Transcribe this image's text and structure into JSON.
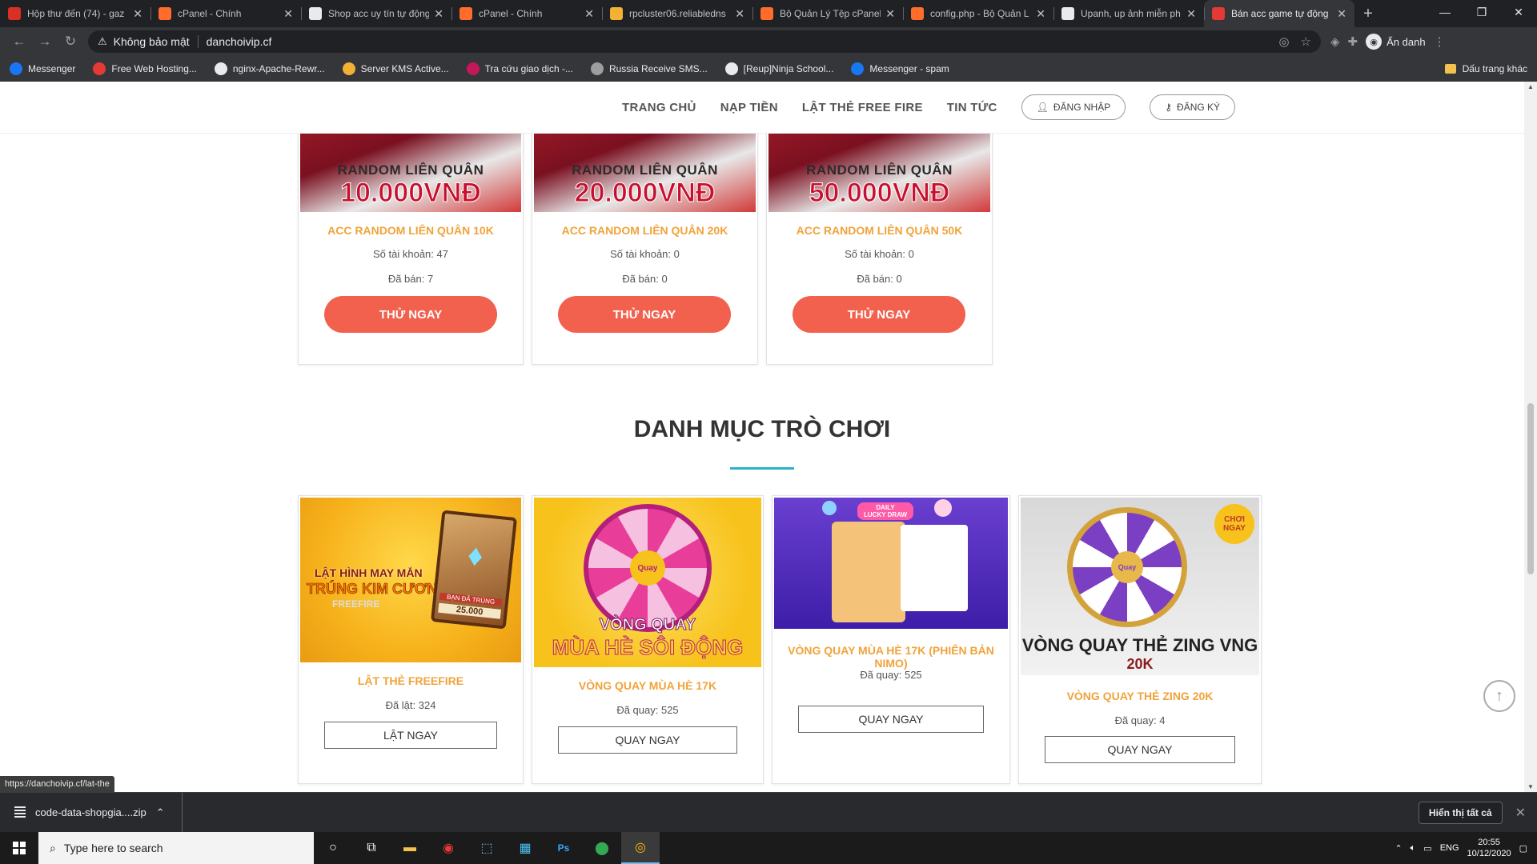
{
  "browser": {
    "tabs": [
      {
        "title": "Hộp thư đến (74) - gaz",
        "icon": "gmail-icon",
        "color": "#d93025",
        "active": false
      },
      {
        "title": "cPanel - Chính",
        "icon": "cpanel-icon",
        "color": "#ff6c2c",
        "active": false
      },
      {
        "title": "Shop acc uy tín tự động",
        "icon": "globe-icon",
        "color": "#e8eaed",
        "active": false
      },
      {
        "title": "cPanel - Chính",
        "icon": "cpanel-icon",
        "color": "#ff6c2c",
        "active": false
      },
      {
        "title": "rpcluster06.reliabledns",
        "icon": "server-icon",
        "color": "#f2b134",
        "active": false
      },
      {
        "title": "Bộ Quản Lý Tệp cPanel",
        "icon": "cpanel-icon",
        "color": "#ff6c2c",
        "active": false
      },
      {
        "title": "config.php - Bộ Quản L",
        "icon": "cpanel-icon",
        "color": "#ff6c2c",
        "active": false
      },
      {
        "title": "Upanh, up ảnh miễn ph",
        "icon": "globe-icon",
        "color": "#e8eaed",
        "active": false
      },
      {
        "title": "Bán acc game tự động",
        "icon": "gift-icon",
        "color": "#e53935",
        "active": true
      }
    ],
    "security_label": "Không bảo mật",
    "url": "danchoivip.cf",
    "incognito_label": "Ẩn danh",
    "bookmarks": [
      {
        "label": "Messenger",
        "icon": "facebook-icon",
        "color": "#1877f2"
      },
      {
        "label": "Free Web Hosting...",
        "icon": "hosting-icon",
        "color": "#e53935"
      },
      {
        "label": "nginx-Apache-Rewr...",
        "icon": "globe-icon",
        "color": "#e8eaed"
      },
      {
        "label": "Server KMS Active...",
        "icon": "star-icon",
        "color": "#f2b134"
      },
      {
        "label": "Tra cứu giao dịch -...",
        "icon": "bank-icon",
        "color": "#c2185b"
      },
      {
        "label": "Russia Receive SMS...",
        "icon": "phone-icon",
        "color": "#9e9e9e"
      },
      {
        "label": "[Reup]Ninja School...",
        "icon": "globe-icon",
        "color": "#e8eaed"
      },
      {
        "label": "Messenger - spam",
        "icon": "facebook-icon",
        "color": "#1877f2"
      }
    ],
    "other_bookmarks": "Dấu trang khác"
  },
  "site": {
    "nav": {
      "home": "TRANG CHỦ",
      "topup": "NẠP TIỀN",
      "flip": "LẬT THẺ FREE FIRE",
      "news": "TIN TỨC",
      "login": "ĐĂNG NHẬP",
      "register": "ĐĂNG KÝ"
    },
    "random_cards": [
      {
        "banner_top": "RANDOM LIÊN QUÂN",
        "banner_price": "10.000VNĐ",
        "title": "ACC RANDOM LIÊN QUÂN 10K",
        "accounts": "Số tài khoản: 47",
        "sold": "Đã bán: 7",
        "button": "THỬ NGAY"
      },
      {
        "banner_top": "RANDOM LIÊN QUÂN",
        "banner_price": "20.000VNĐ",
        "title": "ACC RANDOM LIÊN QUÂN 20K",
        "accounts": "Số tài khoản: 0",
        "sold": "Đã bán: 0",
        "button": "THỬ NGAY"
      },
      {
        "banner_top": "RANDOM LIÊN QUÂN",
        "banner_price": "50.000VNĐ",
        "title": "ACC RANDOM LIÊN QUÂN 50K",
        "accounts": "Số tài khoản: 0",
        "sold": "Đã bán: 0",
        "button": "THỬ NGAY"
      }
    ],
    "section_title": "DANH MỤC TRÒ CHƠI",
    "games": [
      {
        "img_text_1": "LẬT HÌNH MAY MẮN",
        "img_text_2": "TRÚNG KIM CƯƠNG",
        "img_text_3": "FREEFIRE",
        "img_badge": "BẠN ĐÃ TRÚNG",
        "img_value": "25.000",
        "title": "LẬT THẺ FREEFIRE",
        "stat": "Đã lật: 324",
        "button": "LẬT NGAY"
      },
      {
        "img_text_1": "VÒNG QUAY",
        "img_text_2": "MÙA HÈ SÔI ĐỘNG",
        "img_wheel": "Quay",
        "title": "VÒNG QUAY MÙA HÈ 17K",
        "stat": "Đã quay: 525",
        "button": "QUAY NGAY"
      },
      {
        "img_text_1": "DAILY",
        "img_text_2": "LUCKY DRAW",
        "title": "VÒNG QUAY MÙA HÈ 17K (PHIÊN BẢN NIMO)",
        "stat": "Đã quay: 525",
        "button": "QUAY NGAY"
      },
      {
        "img_text_1": "VÒNG QUAY THẺ ZING VNG",
        "img_text_2": "20K",
        "img_badge": "CHƠI NGAY",
        "img_wheel": "Quay",
        "title": "VÒNG QUAY THẺ ZING 20K",
        "stat": "Đã quay: 4",
        "button": "QUAY NGAY"
      }
    ],
    "status_url": "https://danchoivip.cf/lat-the"
  },
  "downloads": {
    "file": "code-data-shopgia....zip",
    "show_all": "Hiển thị tất cả"
  },
  "taskbar": {
    "search_placeholder": "Type here to search",
    "lang": "ENG",
    "time": "20:55",
    "date": "10/12/2020"
  }
}
